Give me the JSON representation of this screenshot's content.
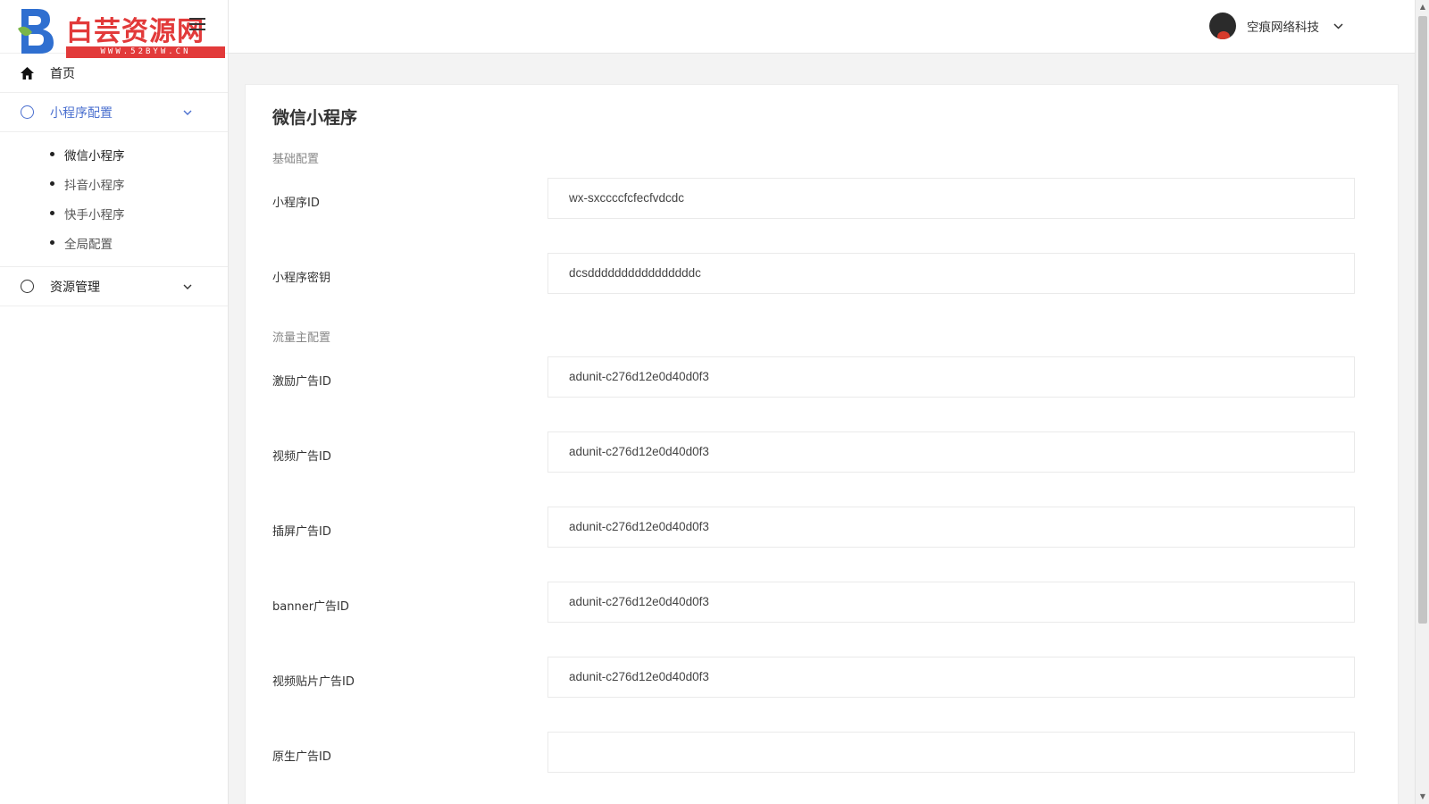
{
  "logo": {
    "text": "白芸资源网",
    "url": "WWW.52BYW.CN"
  },
  "sidebar": {
    "items": [
      {
        "label": "首页",
        "icon": "home-icon"
      },
      {
        "label": "小程序配置",
        "icon": "circle-icon",
        "expanded": true,
        "children": [
          "微信小程序",
          "抖音小程序",
          "快手小程序",
          "全局配置"
        ]
      },
      {
        "label": "资源管理",
        "icon": "circle-icon",
        "expanded": false
      }
    ]
  },
  "header": {
    "user_name": "空痕网络科技"
  },
  "page": {
    "title": "微信小程序",
    "section_basic": "基础配置",
    "section_traffic": "流量主配置",
    "fields": {
      "appid": {
        "label": "小程序ID",
        "value": "wx-sxccccfcfecfvdcdc"
      },
      "secret": {
        "label": "小程序密钥",
        "value": "dcsddddddddddddddddc"
      },
      "reward_ad": {
        "label": "激励广告ID",
        "value": "adunit-c276d12e0d40d0f3"
      },
      "video_ad": {
        "label": "视频广告ID",
        "value": "adunit-c276d12e0d40d0f3"
      },
      "interstitial_ad": {
        "label": "插屏广告ID",
        "value": "adunit-c276d12e0d40d0f3"
      },
      "banner_ad": {
        "label": "banner广告ID",
        "value": "adunit-c276d12e0d40d0f3"
      },
      "video_patch_ad": {
        "label": "视频贴片广告ID",
        "value": "adunit-c276d12e0d40d0f3"
      },
      "native_ad": {
        "label": "原生广告ID",
        "value": ""
      }
    }
  },
  "colors": {
    "accent": "#4a6fcf",
    "logo_red": "#e23a3a",
    "logo_blue": "#2f6fd0",
    "logo_green": "#7ab648"
  }
}
